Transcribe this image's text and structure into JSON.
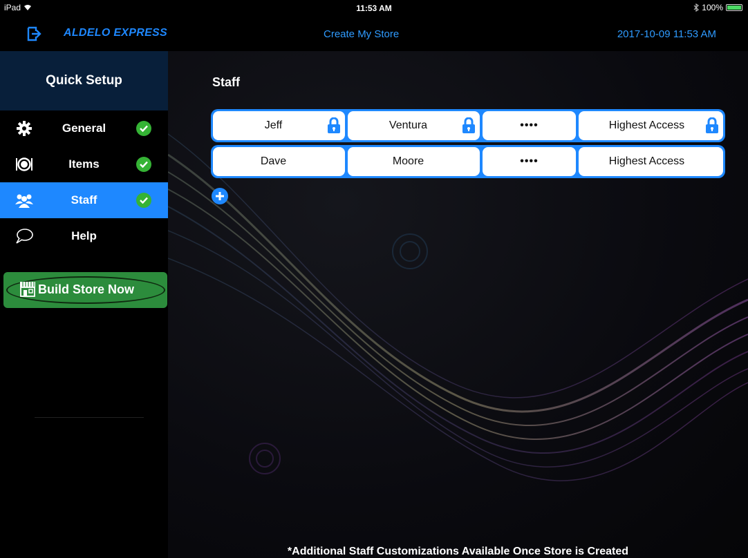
{
  "statusbar": {
    "device": "iPad",
    "time": "11:53 AM",
    "battery": "100%"
  },
  "header": {
    "brand": "ALDELO EXPRESS",
    "title": "Create My Store",
    "datetime": "2017-10-09 11:53 AM"
  },
  "sidebar": {
    "title": "Quick Setup",
    "items": [
      {
        "label": "General",
        "icon": "gear-icon",
        "complete": true
      },
      {
        "label": "Items",
        "icon": "plate-icon",
        "complete": true
      },
      {
        "label": "Staff",
        "icon": "users-icon",
        "complete": true,
        "active": true
      },
      {
        "label": "Help",
        "icon": "speech-bubble-icon",
        "complete": false
      }
    ],
    "build_button": "Build Store Now"
  },
  "main": {
    "section_title": "Staff",
    "staff": [
      {
        "first": "Jeff",
        "last": "Ventura",
        "pin": "••••",
        "access": "Highest Access",
        "locked": true
      },
      {
        "first": "Dave",
        "last": "Moore",
        "pin": "••••",
        "access": "Highest Access",
        "locked": false
      }
    ],
    "footnote": "*Additional Staff Customizations Available Once Store is Created"
  },
  "colors": {
    "accent": "#1e88ff",
    "sidebar_header": "#081f3a",
    "check": "#35b335",
    "build": "#2c8c3c"
  }
}
